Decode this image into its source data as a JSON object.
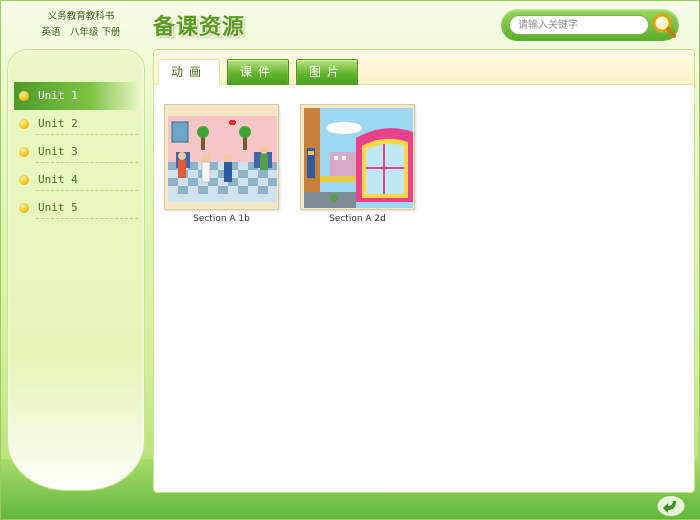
{
  "book": {
    "line1": "义务教育教科书",
    "line2": "英语　八年级  下册"
  },
  "title": "备课资源",
  "search": {
    "placeholder": "请输入关键字",
    "icon": "search-icon"
  },
  "units": [
    {
      "label": "Unit 1",
      "active": true
    },
    {
      "label": "Unit 2",
      "active": false
    },
    {
      "label": "Unit 3",
      "active": false
    },
    {
      "label": "Unit 4",
      "active": false
    },
    {
      "label": "Unit 5",
      "active": false
    }
  ],
  "tabs": [
    {
      "label": "动画",
      "active": true
    },
    {
      "label": "课件",
      "active": false
    },
    {
      "label": "图片",
      "active": false
    }
  ],
  "resources": [
    {
      "caption": "Section A 1b"
    },
    {
      "caption": "Section A 2d"
    }
  ],
  "colors": {
    "brand_green": "#5fb12d",
    "title_green": "#5b9a1e",
    "bullet_gold": "#f7c51b"
  },
  "back_button": {
    "icon": "return-arrow-icon"
  }
}
